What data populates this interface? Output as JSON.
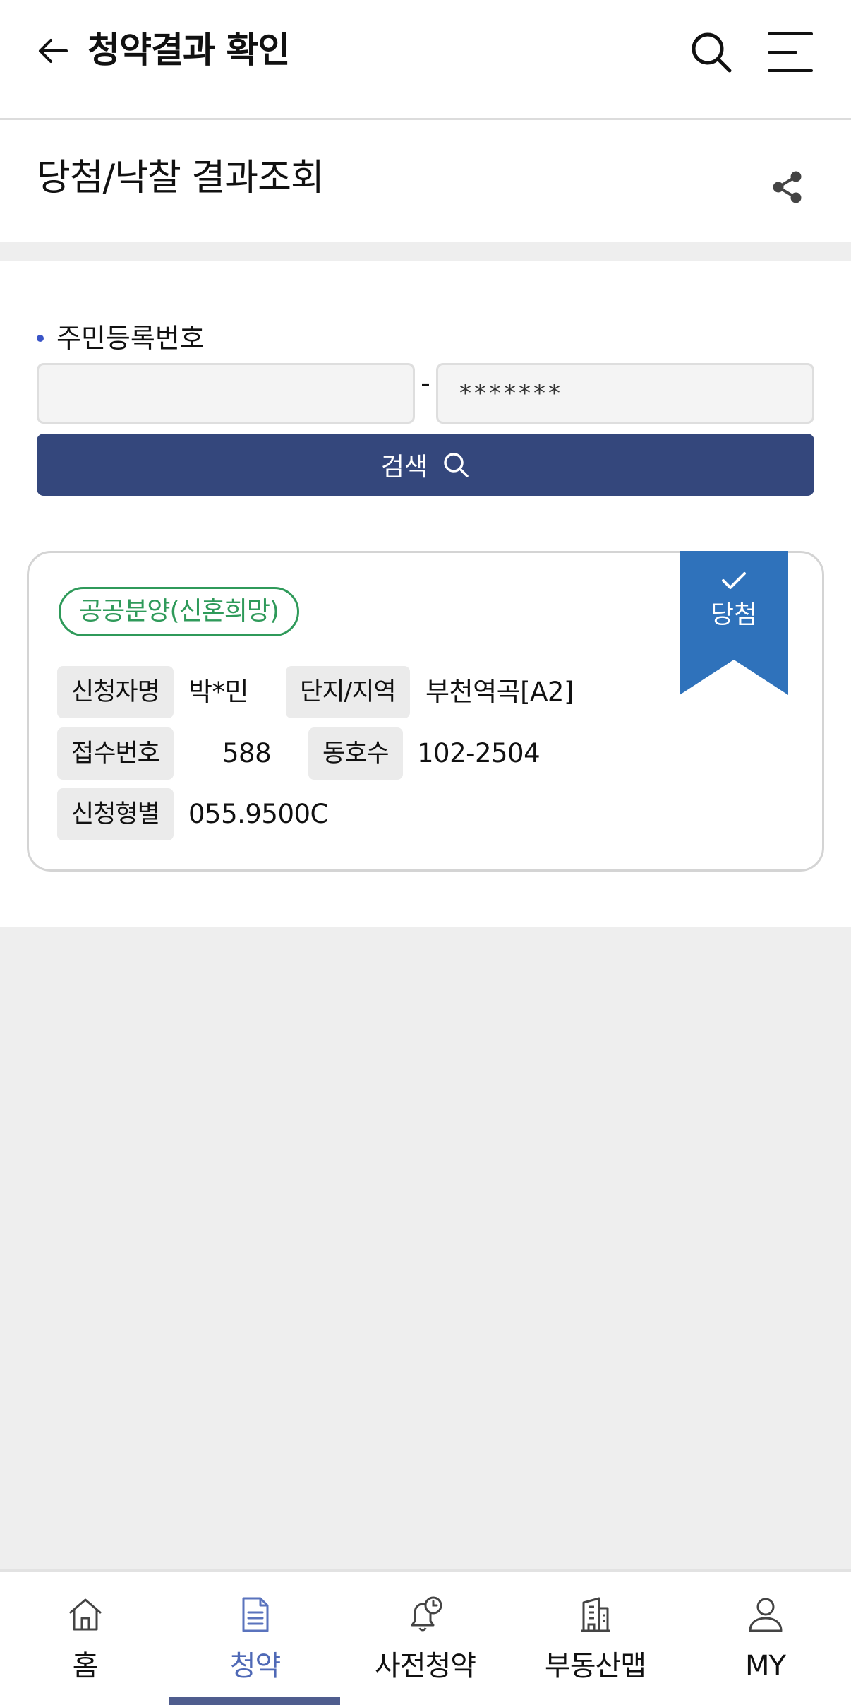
{
  "header": {
    "title": "청약결과 확인",
    "icons": {
      "back": "arrow-left-icon",
      "search": "search-icon",
      "menu": "hamburger-menu-icon"
    }
  },
  "section": {
    "title": "당첨/낙찰 결과조회",
    "share_icon": "share-icon"
  },
  "form": {
    "label": "주민등록번호",
    "front_value": "",
    "back_placeholder": "*******",
    "separator": "-",
    "search_label": "검색",
    "accent_color": "#34477c"
  },
  "result": {
    "category": "공공분양(신혼희망)",
    "status": "당첨",
    "status_color": "#2f72bb",
    "fields": {
      "applicant": {
        "label": "신청자명",
        "value": "박*민"
      },
      "complex": {
        "label": "단지/지역",
        "value": "부천역곡[A2]"
      },
      "receipt": {
        "label": "접수번호",
        "value": "588"
      },
      "unit": {
        "label": "동호수",
        "value": "102-2504"
      },
      "type": {
        "label": "신청형별",
        "value": "055.9500C"
      }
    }
  },
  "nav": {
    "items": [
      {
        "label": "홈",
        "icon": "home-icon"
      },
      {
        "label": "청약",
        "icon": "document-icon",
        "active": true
      },
      {
        "label": "사전청약",
        "icon": "bell-clock-icon"
      },
      {
        "label": "부동산맵",
        "icon": "building-icon"
      },
      {
        "label": "MY",
        "icon": "user-icon"
      }
    ]
  }
}
